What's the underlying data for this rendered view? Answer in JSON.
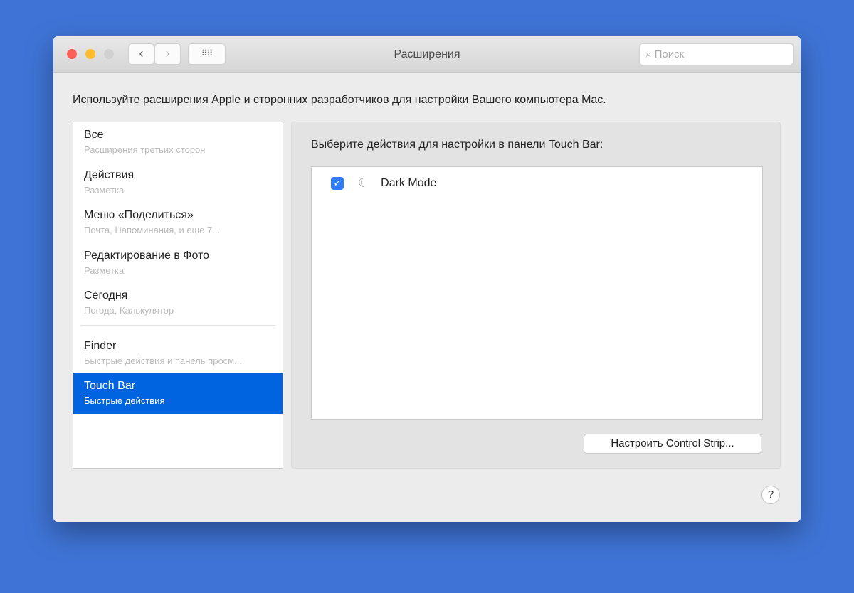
{
  "window": {
    "title": "Расширения",
    "search_placeholder": "Поиск"
  },
  "description": "Используйте расширения Apple и сторонних разработчиков для настройки Вашего компьютера Mac.",
  "sidebar": {
    "items": [
      {
        "name": "Все",
        "sub": "Расширения третьих сторон"
      },
      {
        "name": "Действия",
        "sub": "Разметка"
      },
      {
        "name": "Меню «Поделиться»",
        "sub": "Почта, Напоминания, и еще 7..."
      },
      {
        "name": "Редактирование в Фото",
        "sub": "Разметка"
      },
      {
        "name": "Сегодня",
        "sub": "Погода, Калькулятор"
      },
      {
        "name": "Finder",
        "sub": "Быстрые действия и панель просм..."
      },
      {
        "name": "Touch Bar",
        "sub": "Быстрые действия",
        "selected": true
      }
    ]
  },
  "panel": {
    "label": "Выберите действия для настройки в панели Touch Bar:",
    "actions": [
      {
        "name": "Dark Mode",
        "checked": true
      }
    ],
    "control_strip_button": "Настроить Control Strip..."
  },
  "help": "?"
}
